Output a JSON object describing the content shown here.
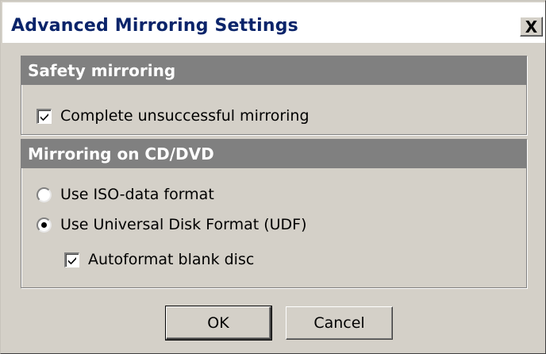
{
  "window": {
    "title": "Advanced Mirroring Settings",
    "close_label": "X"
  },
  "safety_group": {
    "header": "Safety mirroring",
    "complete_unsuccessful": {
      "label": "Complete unsuccessful mirroring",
      "checked": true
    }
  },
  "cd_group": {
    "header": "Mirroring on CD/DVD",
    "iso_option": {
      "label": "Use ISO-data format",
      "selected": false
    },
    "udf_option": {
      "label": "Use Universal Disk Format (UDF)",
      "selected": true
    },
    "autoformat": {
      "label": "Autoformat blank disc",
      "checked": true
    }
  },
  "buttons": {
    "ok": "OK",
    "cancel": "Cancel"
  }
}
